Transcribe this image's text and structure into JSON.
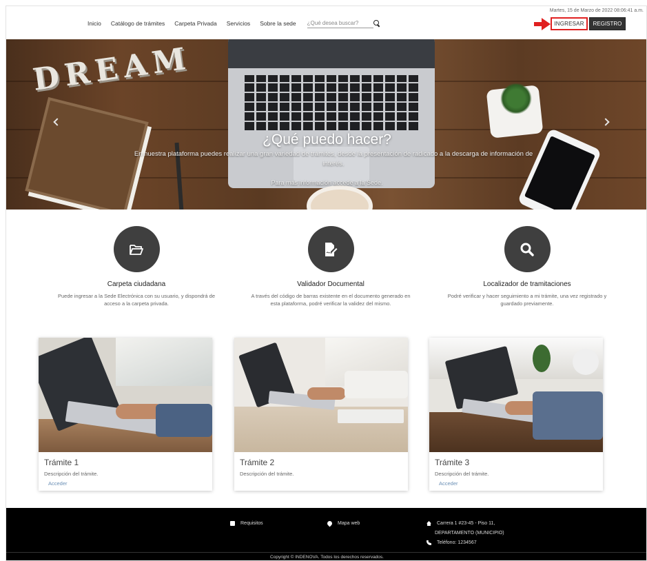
{
  "header": {
    "date": "Martes, 15 de Marzo de 2022 08:06:41 a.m.",
    "nav": [
      "Inicio",
      "Catálogo de trámites",
      "Carpeta Privada",
      "Servicios",
      "Sobre la sede"
    ],
    "search_placeholder": "¿Qué desea buscar?",
    "login_label": "INGRESAR",
    "register_label": "REGISTRO",
    "highlight_color": "#e02020"
  },
  "hero": {
    "title": "¿Qué puedo hacer?",
    "text": "En nuestra plataforma puedes realizar una gran variedad de trámites, desde la presentación de radicado a la descarga de información de interés.",
    "more": "Para más información accede a la Sede.",
    "image_text": "DREAM"
  },
  "features": [
    {
      "icon": "folder-open-icon",
      "title": "Carpeta ciudadana",
      "desc": "Puede ingresar a la Sede Electrónica con su usuario, y dispondrá de acceso a la carpeta privada."
    },
    {
      "icon": "document-edit-icon",
      "title": "Validador Documental",
      "desc": "A través del código de barras existente en el documento generado en esta plataforma, podré verificar la validez del mismo."
    },
    {
      "icon": "search-icon",
      "title": "Localizador de tramitaciones",
      "desc": "Podré verificar y hacer seguimiento a mi trámite, una vez registrado y guardado previamente."
    }
  ],
  "cards": [
    {
      "title": "Trámite 1",
      "desc": "Descripción del trámite.",
      "link": "Acceder"
    },
    {
      "title": "Trámite 2",
      "desc": "Descripción del trámite.",
      "link": ""
    },
    {
      "title": "Trámite 3",
      "desc": "Descripción del trámite.",
      "link": "Acceder"
    }
  ],
  "footer": {
    "requirements": "Requisitos",
    "sitemap": "Mapa web",
    "address_line1": "Carrera 1 #23-45 - Piso 11,",
    "address_line2": "DEPARTAMENTO (MUNICIPIO)",
    "phone": "Teléfono: 1234567",
    "copyright": "Copyright © INDENOVA. Todos los derechos reservados."
  }
}
